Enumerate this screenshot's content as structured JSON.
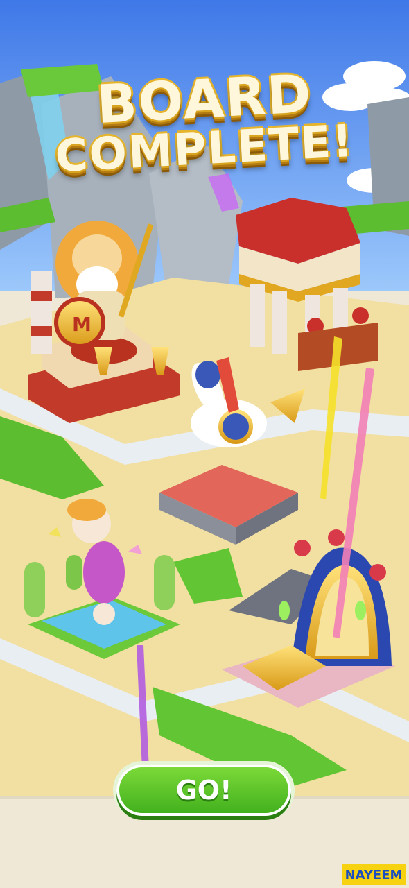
{
  "headline": {
    "line1": "BOARD",
    "line2": "COMPLETE!"
  },
  "go_button": {
    "label": "GO!"
  },
  "watermark": {
    "text": "NAYEEM"
  },
  "colors": {
    "sky": "#5a8ff0",
    "sand": "#f2dfa2",
    "go_green": "#4fbf22",
    "title_gold": "#e6b52c"
  }
}
